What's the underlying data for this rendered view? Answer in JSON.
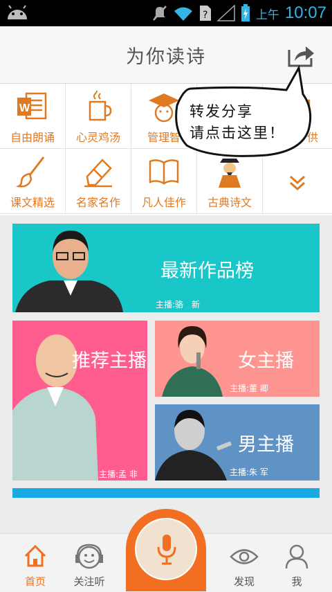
{
  "status_bar": {
    "ampm": "上午",
    "time": "10:07"
  },
  "header": {
    "title": "为你读诗"
  },
  "share_bubble": {
    "line1": "转发分享",
    "line2": "请点击这里！"
  },
  "categories": [
    {
      "label": "自由朗诵",
      "icon": "word-document-icon"
    },
    {
      "label": "心灵鸡汤",
      "icon": "coffee-cup-icon"
    },
    {
      "label": "管理智",
      "icon": "graduation-cap-icon"
    },
    {
      "label": "",
      "icon": "hidden-icon"
    },
    {
      "label": "供",
      "icon": "hidden-icon"
    },
    {
      "label": "课文精选",
      "icon": "paintbrush-icon"
    },
    {
      "label": "名家名作",
      "icon": "eraser-icon"
    },
    {
      "label": "凡人佳作",
      "icon": "open-book-icon"
    },
    {
      "label": "古典诗文",
      "icon": "scholar-icon"
    },
    {
      "label": "",
      "icon": "expand-chevron-icon"
    }
  ],
  "cards": {
    "latest": {
      "title": "最新作品榜",
      "host": "主播:骆　新",
      "color": "#19c7c9"
    },
    "recommend": {
      "title": "推荐主播",
      "host": "主播:孟 非",
      "color": "#ff5d8f"
    },
    "female": {
      "title": "女主播",
      "host": "主播:董 卿",
      "color": "#ff9590"
    },
    "male": {
      "title": "男主播",
      "host": "主播:朱 军",
      "color": "#5f93c6"
    }
  },
  "bottom_nav": {
    "home": "首页",
    "follow": "关注听",
    "discover": "发现",
    "me": "我"
  },
  "colors": {
    "accent": "#e07a22",
    "nav_active": "#f26f21"
  }
}
